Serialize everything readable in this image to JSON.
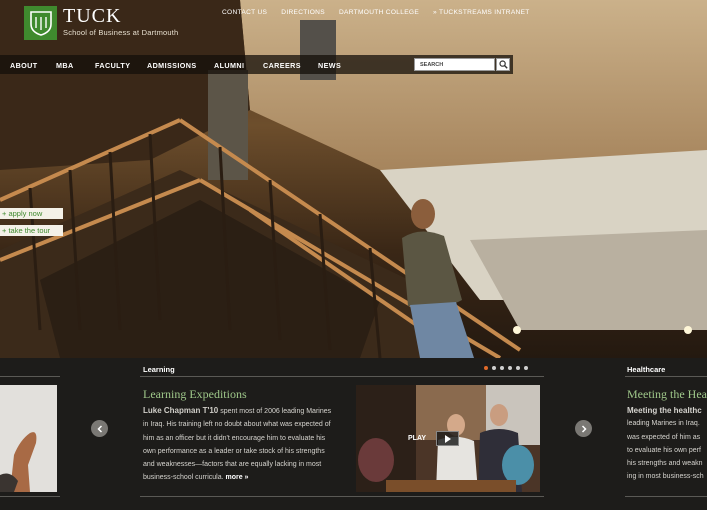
{
  "brand": {
    "title": "TUCK",
    "subtitle": "School of Business at Dartmouth",
    "logo_color": "#3f8a2e"
  },
  "utility_nav": [
    {
      "label": "CONTACT US"
    },
    {
      "label": "DIRECTIONS"
    },
    {
      "label": "DARTMOUTH COLLEGE"
    },
    {
      "label": "» TUCKSTREAMS INTRANET"
    }
  ],
  "main_nav": [
    {
      "label": "ABOUT"
    },
    {
      "label": "MBA"
    },
    {
      "label": "FACULTY"
    },
    {
      "label": "ADMISSIONS"
    },
    {
      "label": "ALUMNI"
    },
    {
      "label": "CAREERS"
    },
    {
      "label": "NEWS"
    }
  ],
  "search": {
    "placeholder": "SEARCH",
    "icon": "magnifier-icon"
  },
  "side_links": [
    {
      "label": "+ apply now"
    },
    {
      "label": "+ take the tour"
    }
  ],
  "feature": {
    "section": "Learning",
    "title": "Learning Expeditions",
    "lead_name": "Luke Chapman T'10",
    "lines": [
      "spent most of 2006 leading Marines",
      "in Iraq. His training left no doubt about what was expected of",
      "him as an officer but it didn't encourage him to evaluate his",
      "own performance as a leader or take stock of his strengths",
      "and weaknesses—factors that are equally lacking in most",
      "business-school curricula."
    ],
    "more": "more »",
    "video_label": "PLAY",
    "accent": "#e06a2a"
  },
  "next_feature": {
    "section": "Healthcare",
    "title": "Meeting the Hea",
    "lines": [
      "Meeting the healthc",
      "leading Marines in Iraq.",
      "was expected of him as",
      "to evaluate his own perf",
      "his strengths and weakn",
      "ing in most business-sch"
    ]
  },
  "carousel": {
    "pages": 6,
    "active_index": 0
  }
}
